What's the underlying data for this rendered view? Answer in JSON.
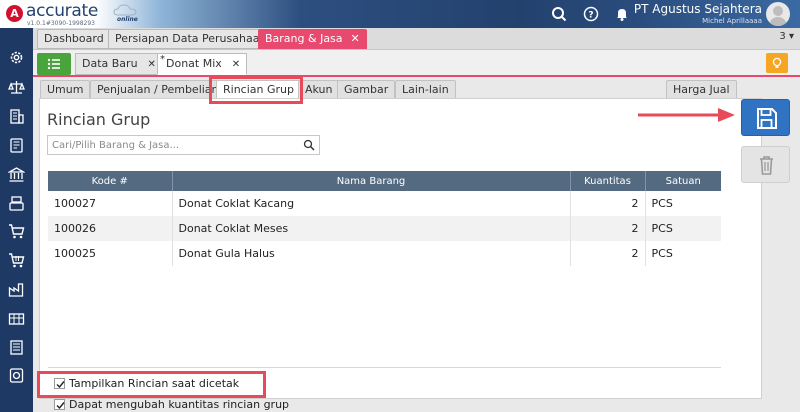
{
  "app": {
    "logo_text": "accurate",
    "logo_sub": "online",
    "version": "v1.0.1#3090-1998293",
    "company_name": "PT Agustus Sejahtera",
    "user_name": "Michel Aprillaaaa"
  },
  "module_tabs": [
    {
      "label": "Dashboard"
    },
    {
      "label": "Persiapan Data Perusahaan"
    },
    {
      "label": "Barang & Jasa",
      "close": "✕"
    }
  ],
  "tab_count": "3",
  "doc_tabs": [
    {
      "label": "Data Baru",
      "close": "✕"
    },
    {
      "label": "Donat Mix",
      "close": "✕",
      "star": "*"
    }
  ],
  "sub_tabs": [
    "Umum",
    "Penjualan / Pembelian",
    "Rincian Grup",
    "Akun",
    "Gambar",
    "Lain-lain",
    "Harga Jual"
  ],
  "panel": {
    "title": "Rincian Grup",
    "search_placeholder": "Cari/Pilih Barang & Jasa..."
  },
  "table": {
    "columns": [
      "Kode #",
      "Nama Barang",
      "Kuantitas",
      "Satuan"
    ],
    "rows": [
      {
        "kode": "100027",
        "nama": "Donat Coklat Kacang",
        "qty": "2",
        "satuan": "PCS"
      },
      {
        "kode": "100026",
        "nama": "Donat Coklat Meses",
        "qty": "2",
        "satuan": "PCS"
      },
      {
        "kode": "100025",
        "nama": "Donat Gula Halus",
        "qty": "2",
        "satuan": "PCS"
      }
    ]
  },
  "options": [
    {
      "label": "Tampilkan Rincian saat dicetak",
      "checked": true
    },
    {
      "label": "Dapat mengubah kuantitas rincian grup",
      "checked": true
    }
  ],
  "colors": {
    "accent_pink": "#e8496e",
    "sidebar_navy": "#1e3a64",
    "save_blue": "#2f73c2",
    "highlight_red": "#e84a5a"
  },
  "icons": {
    "search": "search-icon",
    "help": "help-icon",
    "bell": "bell-icon",
    "save": "save-icon",
    "delete": "trash-icon",
    "list": "list-icon",
    "bulb": "lightbulb-icon"
  }
}
